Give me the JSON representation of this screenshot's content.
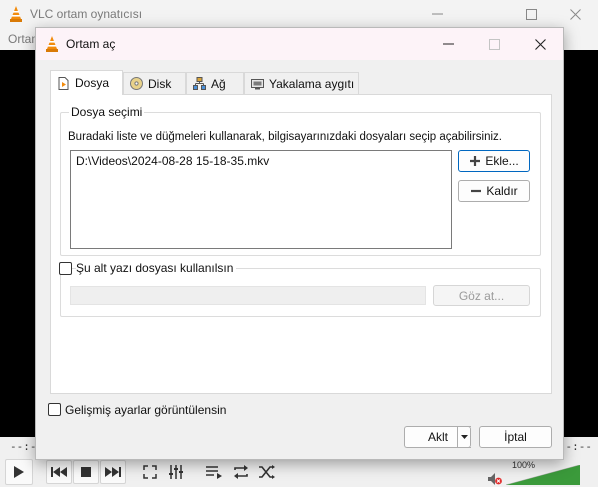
{
  "vlc": {
    "title": "VLC ortam oynatıcısı",
    "menu_label": "Ortam",
    "time_elapsed": "--:--",
    "time_total": "--:--",
    "volume": "100%"
  },
  "dialog": {
    "title": "Ortam aç",
    "tabs": [
      {
        "label": "Dosya",
        "icon": "file-icon"
      },
      {
        "label": "Disk",
        "icon": "disc-icon"
      },
      {
        "label": "Ağ",
        "icon": "network-icon"
      },
      {
        "label": "Yakalama aygıtı",
        "icon": "capture-device-icon"
      }
    ],
    "file_selection": {
      "title": "Dosya seçimi",
      "description": "Buradaki liste ve düğmeleri kullanarak, bilgisayarınızdaki dosyaları seçip açabilirsiniz.",
      "files": [
        "D:\\Videos\\2024-08-28 15-18-35.mkv"
      ],
      "add_label": "Ekle...",
      "remove_label": "Kaldır"
    },
    "subtitle": {
      "checkbox_label": "Şu alt yazı dosyası kullanılsın",
      "checked": false,
      "path_value": "",
      "browse_label": "Göz at..."
    },
    "advanced_label": "Gelişmiş ayarlar görüntülensin",
    "advanced_checked": false,
    "open_label": "Aklt",
    "cancel_label": "İptal"
  },
  "colors": {
    "vlc_orange": "#f28b0c",
    "dialog_titlebar": "#fdf3f8",
    "focus_blue": "#0067c0"
  }
}
